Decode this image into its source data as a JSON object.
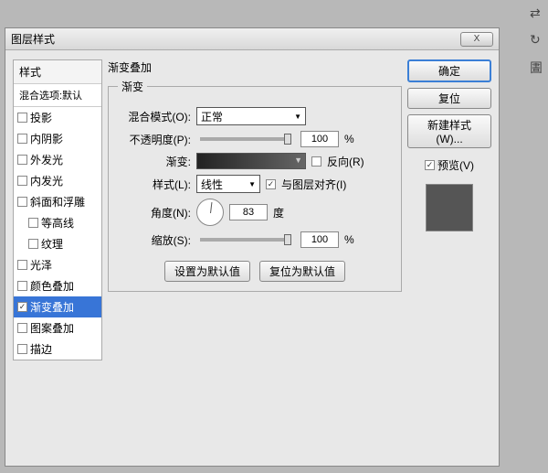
{
  "window": {
    "title": "图层样式"
  },
  "sidebar": {
    "header": "样式",
    "sub": "混合选项:默认",
    "items": [
      {
        "label": "投影",
        "checked": false
      },
      {
        "label": "内阴影",
        "checked": false
      },
      {
        "label": "外发光",
        "checked": false
      },
      {
        "label": "内发光",
        "checked": false
      },
      {
        "label": "斜面和浮雕",
        "checked": false
      },
      {
        "label": "等高线",
        "checked": false,
        "indent": true
      },
      {
        "label": "纹理",
        "checked": false,
        "indent": true
      },
      {
        "label": "光泽",
        "checked": false
      },
      {
        "label": "颜色叠加",
        "checked": false
      },
      {
        "label": "渐变叠加",
        "checked": true,
        "selected": true
      },
      {
        "label": "图案叠加",
        "checked": false
      },
      {
        "label": "描边",
        "checked": false
      }
    ]
  },
  "main": {
    "group_title": "渐变叠加",
    "fieldset_title": "渐变",
    "blend_mode": {
      "label": "混合模式(O):",
      "value": "正常"
    },
    "opacity": {
      "label": "不透明度(P):",
      "value": "100",
      "suffix": "%"
    },
    "gradient": {
      "label": "渐变:",
      "reverse_label": "反向(R)",
      "reverse": false
    },
    "style": {
      "label": "样式(L):",
      "value": "线性",
      "align_label": "与图层对齐(I)",
      "align": true
    },
    "angle": {
      "label": "角度(N):",
      "value": "83",
      "suffix": "度"
    },
    "scale": {
      "label": "缩放(S):",
      "value": "100",
      "suffix": "%"
    },
    "btn_default": "设置为默认值",
    "btn_reset": "复位为默认值"
  },
  "right": {
    "ok": "确定",
    "reset": "复位",
    "new_style": "新建样式(W)...",
    "preview_label": "预览(V)",
    "preview_checked": true
  }
}
